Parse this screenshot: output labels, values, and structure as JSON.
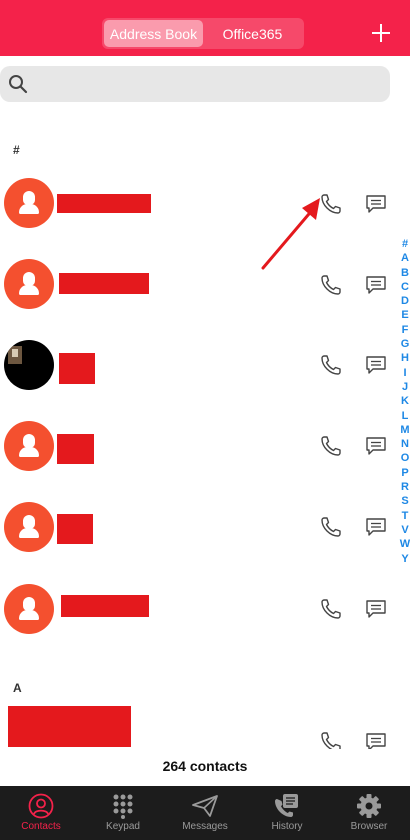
{
  "header": {
    "segments": [
      {
        "label": "Address Book",
        "active": true
      },
      {
        "label": "Office365",
        "active": false
      }
    ],
    "add_icon": "plus-icon"
  },
  "search": {
    "placeholder": "",
    "value": "",
    "icon": "search-icon"
  },
  "sections": [
    "#",
    "A"
  ],
  "index_letters": [
    "#",
    "A",
    "B",
    "C",
    "D",
    "E",
    "F",
    "G",
    "H",
    "I",
    "J",
    "K",
    "L",
    "M",
    "N",
    "O",
    "P",
    "R",
    "S",
    "T",
    "V",
    "W",
    "Y"
  ],
  "contacts_count": "264 contacts",
  "tabs": [
    {
      "label": "Contacts",
      "icon": "contacts-icon",
      "active": true
    },
    {
      "label": "Keypad",
      "icon": "keypad-icon",
      "active": false
    },
    {
      "label": "Messages",
      "icon": "paper-plane-icon",
      "active": false
    },
    {
      "label": "History",
      "icon": "call-history-icon",
      "active": false
    },
    {
      "label": "Browser",
      "icon": "gear-icon",
      "active": false
    }
  ],
  "colors": {
    "brand": "#f4224a",
    "avatar": "#f4502f",
    "redaction": "#e4191d",
    "index_letter": "#1e88e5",
    "tabbar": "#1c1c1c"
  }
}
